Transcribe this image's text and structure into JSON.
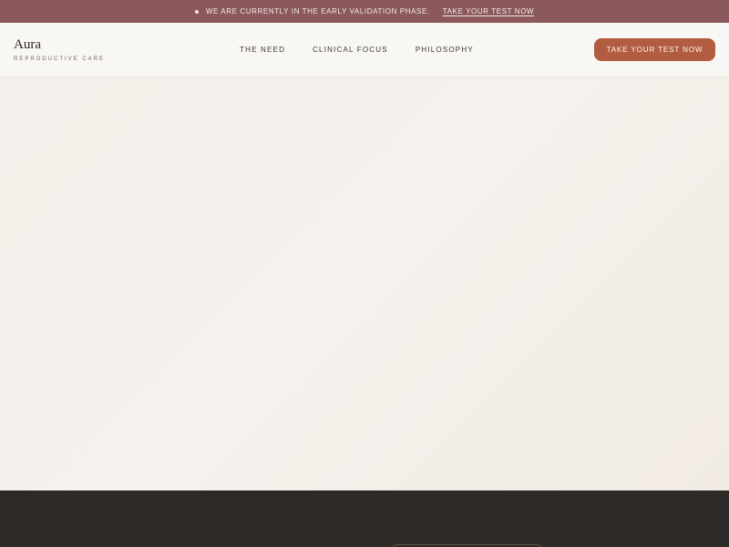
{
  "announcement": {
    "message": "We are currently in the early validation phase.",
    "link_label": "Take your test now"
  },
  "brand": {
    "name": "Aura",
    "tagline": "Reproductive Care"
  },
  "nav": {
    "items": [
      {
        "label": "The Need"
      },
      {
        "label": "Clinical Focus"
      },
      {
        "label": "Philosophy"
      }
    ]
  },
  "header": {
    "cta_label": "Take your test now"
  },
  "colors": {
    "announcement_bg": "#8b585c",
    "header_bg": "#f9f7f3",
    "hero_bg": "#f2ede7",
    "accent": "#b25d42",
    "dark_section": "#2e2a27"
  }
}
